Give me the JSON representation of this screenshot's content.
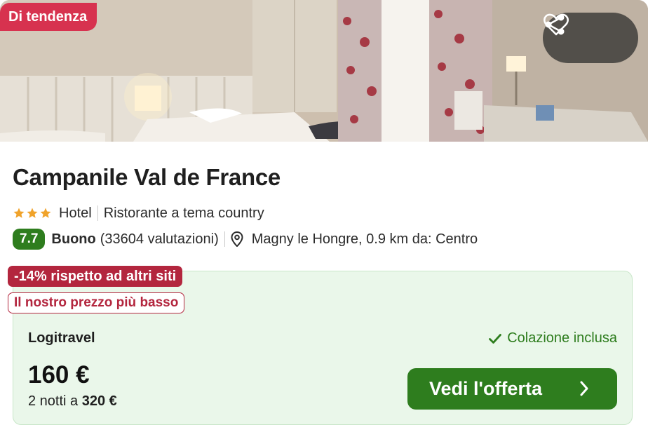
{
  "hero": {
    "trend_badge": "Di tendenza",
    "icons": {
      "share": "share-icon",
      "favorite": "heart-icon"
    }
  },
  "hotel": {
    "name": "Campanile Val de France",
    "stars": 3,
    "type": "Hotel",
    "feature": "Ristorante a tema country",
    "score": "7.7",
    "rating_word": "Buono",
    "reviews": "(33604 valutazioni)",
    "location": "Magny le Hongre, 0.9 km da: Centro"
  },
  "offer": {
    "discount_badge": "-14% rispetto ad altri siti",
    "lowest_badge": "Il nostro prezzo più basso",
    "provider": "Logitravel",
    "breakfast": "Colazione inclusa",
    "price": "160 €",
    "nights_text": "2 notti a",
    "total": "320 €",
    "cta": "Vedi l'offerta"
  },
  "colors": {
    "trend": "#d7324f",
    "discount": "#b3263e",
    "score": "#2e7d1e",
    "cta": "#2e7d1e",
    "offer_bg": "#eaf7ea"
  }
}
